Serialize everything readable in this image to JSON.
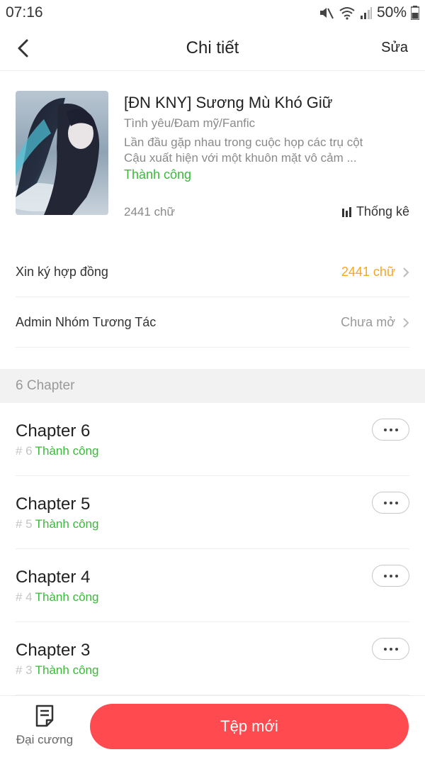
{
  "status_bar": {
    "time": "07:16",
    "battery": "50%"
  },
  "nav": {
    "title": "Chi tiết",
    "edit": "Sửa"
  },
  "book": {
    "title": "[ĐN KNY] Sương Mù Khó Giữ",
    "genre": "Tình yêu/Đam mỹ/Fanfic",
    "desc_line1": "Lần đầu gặp nhau trong cuộc họp các trụ cột",
    "desc_line2": "Cậu xuất hiện với một khuôn mặt vô cảm ...",
    "status": "Thành công",
    "word_count": "2441 chữ",
    "stats_label": "Thống kê"
  },
  "rows": [
    {
      "label": "Xin ký hợp đồng",
      "value": "2441 chữ"
    },
    {
      "label": "Admin Nhóm Tương Tác",
      "value": "Chưa mở"
    }
  ],
  "section": {
    "label": "6 Chapter"
  },
  "chapters": [
    {
      "title": "Chapter 6",
      "num": "# 6",
      "status": "Thành công"
    },
    {
      "title": "Chapter 5",
      "num": "# 5",
      "status": "Thành công"
    },
    {
      "title": "Chapter 4",
      "num": "# 4",
      "status": "Thành công"
    },
    {
      "title": "Chapter 3",
      "num": "# 3",
      "status": "Thành công"
    }
  ],
  "bottom": {
    "outline_label": "Đại cương",
    "new_button": "Tệp mới"
  },
  "colors": {
    "accent": "#ff4a4f",
    "success": "#3cb83c",
    "orange": "#f5a623"
  },
  "icons": [
    "back-arrow-icon",
    "mute-icon",
    "wifi-icon",
    "signal-icon",
    "battery-icon",
    "bar-chart-icon",
    "chevron-right-icon",
    "more-icon",
    "document-icon"
  ]
}
